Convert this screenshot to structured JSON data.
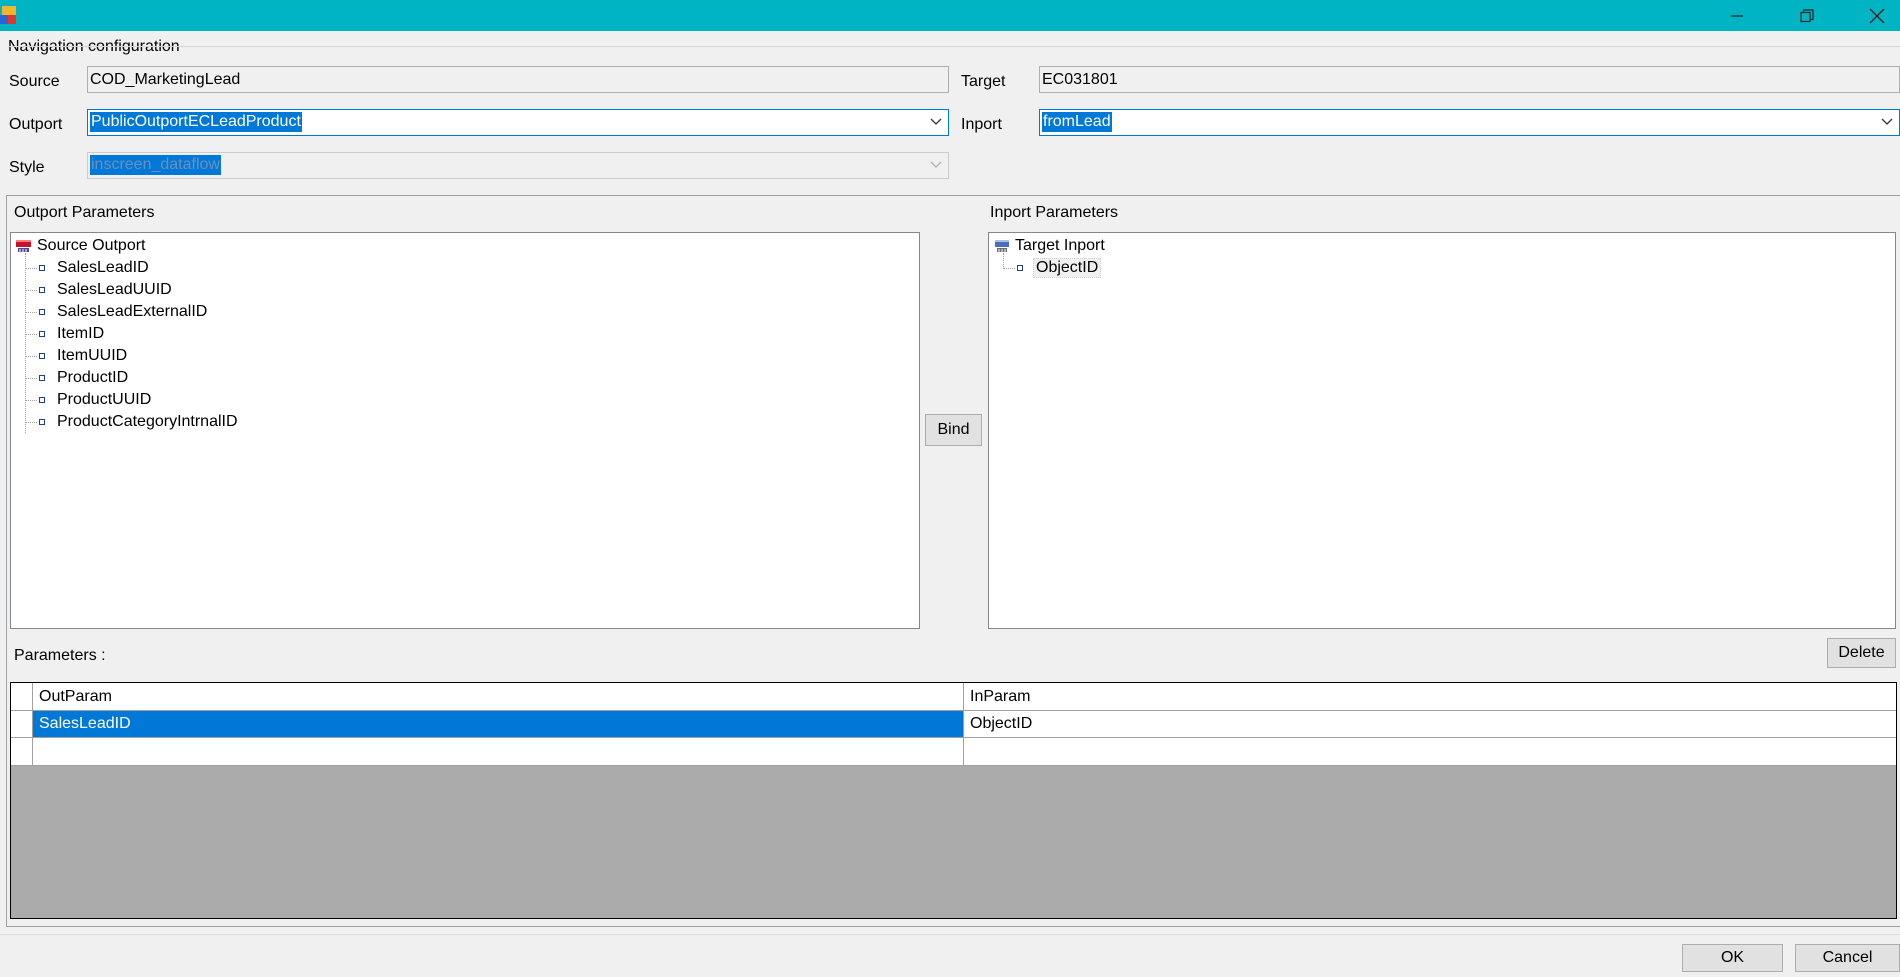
{
  "titlebar": {
    "minimize_icon": "minimize-icon",
    "restore_icon": "restore-icon",
    "close_icon": "close-icon"
  },
  "navigation": {
    "group_title": "Navigation configuration",
    "source_label": "Source",
    "source_value": "COD_MarketingLead",
    "target_label": "Target",
    "target_value": "EC031801",
    "outport_label": "Outport",
    "outport_value": "PublicOutportECLeadProduct",
    "inport_label": "Inport",
    "inport_value": "fromLead",
    "style_label": "Style",
    "style_value": "inscreen_dataflow"
  },
  "outport_params": {
    "title": "Outport Parameters",
    "root_label": "Source Outport",
    "items": [
      "SalesLeadID",
      "SalesLeadUUID",
      "SalesLeadExternalID",
      "ItemID",
      "ItemUUID",
      "ProductID",
      "ProductUUID",
      "ProductCategoryIntrnalID"
    ]
  },
  "inport_params": {
    "title": "Inport Parameters",
    "root_label": "Target Inport",
    "items": [
      "ObjectID"
    ]
  },
  "bind_label": "Bind",
  "parameters": {
    "label": "Parameters  :",
    "delete_label": "Delete",
    "columns": [
      "OutParam",
      "InParam"
    ],
    "rows": [
      [
        "SalesLeadID",
        "ObjectID"
      ]
    ]
  },
  "footer": {
    "ok_label": "OK",
    "cancel_label": "Cancel"
  },
  "colors": {
    "titlebar": "#00b4c4",
    "selection": "#0078d7"
  }
}
